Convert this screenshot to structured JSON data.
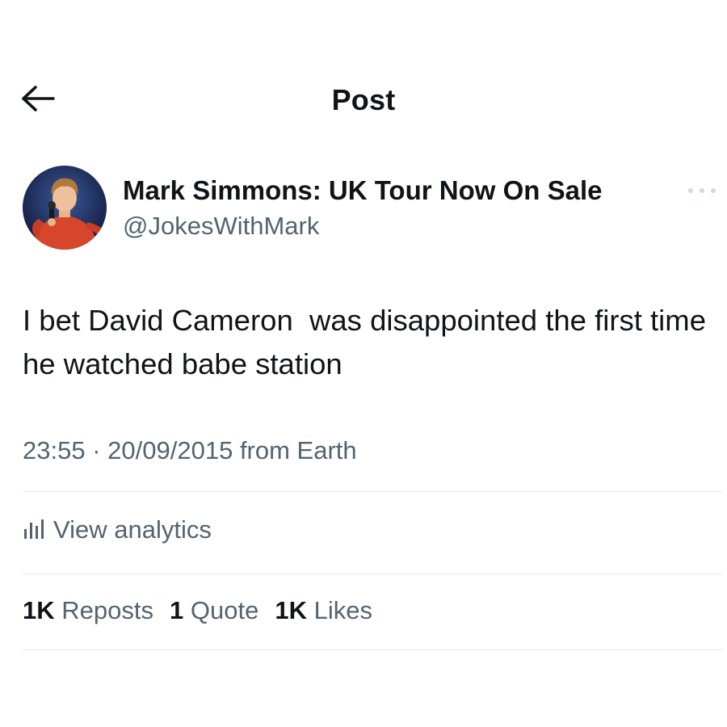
{
  "header": {
    "title": "Post",
    "back_icon": "arrow-left-icon"
  },
  "author": {
    "display_name": "Mark Simmons: UK Tour Now On Sale",
    "handle": "@JokesWithMark",
    "avatar_icon": "avatar-photo"
  },
  "more_icon": "more-horizontal-icon",
  "post": {
    "text": "I bet David Cameron  was disappointed the first time he watched babe station",
    "time": "23:55",
    "separator": "·",
    "date": "20/09/2015",
    "source": "from Earth"
  },
  "analytics": {
    "label": "View analytics",
    "icon": "bar-chart-icon"
  },
  "stats": {
    "reposts_count": "1K",
    "reposts_label": "Reposts",
    "quotes_count": "1",
    "quotes_label": "Quote",
    "likes_count": "1K",
    "likes_label": "Likes"
  },
  "colors": {
    "text_primary": "#0f1419",
    "text_secondary": "#536471",
    "divider": "#e7e9ea",
    "background": "#ffffff"
  }
}
